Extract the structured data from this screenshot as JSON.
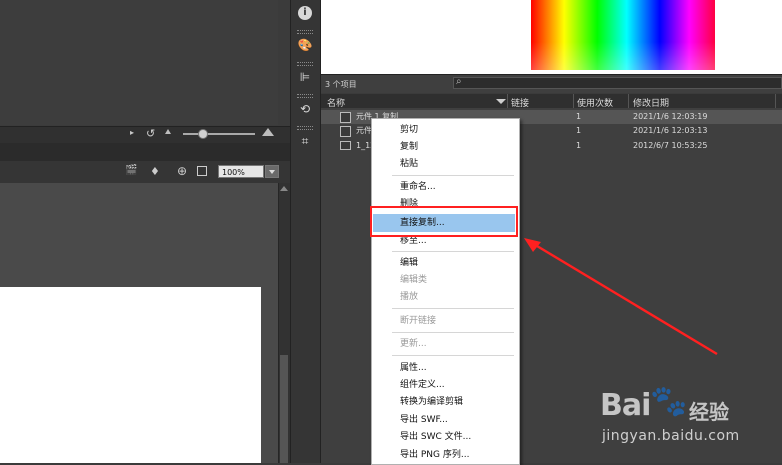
{
  "timeline": {
    "zoom_value": "100%"
  },
  "library": {
    "item_count": "3 个项目",
    "columns": {
      "name": "名称",
      "link": "链接",
      "use_count": "使用次数",
      "modified": "修改日期"
    },
    "rows": [
      {
        "name": "元件 1 复制",
        "use_count": "1",
        "modified": "2021/1/6 12:03:19"
      },
      {
        "name": "元件",
        "use_count": "1",
        "modified": "2021/1/6 12:03:13"
      },
      {
        "name": "1_12",
        "use_count": "1",
        "modified": "2012/6/7 10:53:25"
      }
    ]
  },
  "context_menu": {
    "cut": "剪切",
    "copy": "复制",
    "paste": "粘贴",
    "rename": "重命名...",
    "delete": "删除",
    "duplicate": "直接复制...",
    "move_to": "移至...",
    "edit": "编辑",
    "edit_class": "编辑类",
    "play": "播放",
    "break_link": "断开链接",
    "update": "更新...",
    "properties": "属性...",
    "component_def": "组件定义...",
    "convert_compiled": "转换为编译剪辑",
    "export_swf": "导出 SWF...",
    "export_swc": "导出 SWC 文件...",
    "export_png": "导出 PNG 序列..."
  },
  "colors": {
    "highlight": "#99c6ee",
    "annotation": "#ff2020"
  },
  "watermark": {
    "brand": "Bai",
    "product": "经验",
    "url": "jingyan.baidu.com"
  }
}
